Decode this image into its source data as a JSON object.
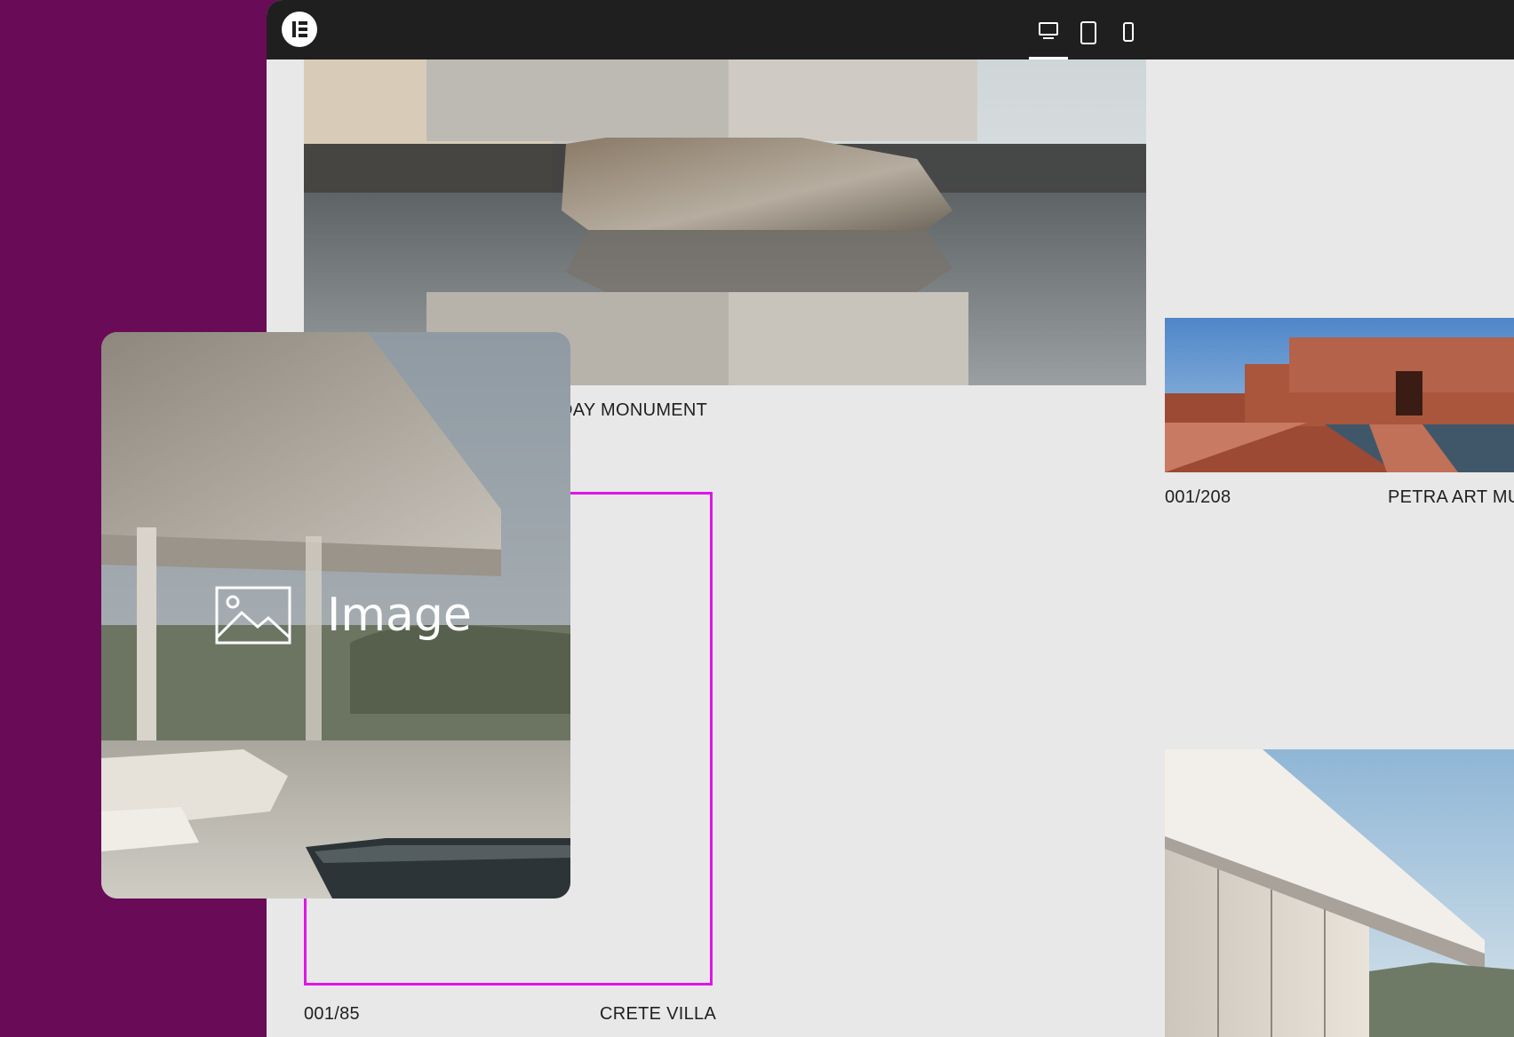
{
  "app": {
    "logo_icon": "elementor-logo-icon",
    "brand_color": "#690b57",
    "accent_color": "#e015e8"
  },
  "device_switcher": {
    "items": [
      {
        "icon": "desktop-icon",
        "active": true
      },
      {
        "icon": "tablet-icon",
        "active": false
      },
      {
        "icon": "mobile-icon",
        "active": false
      }
    ]
  },
  "canvas": {
    "projects": [
      {
        "caption_name": "DAY MONUMENT"
      },
      {
        "caption_number": "001/208",
        "caption_name": "PETRA ART MU"
      },
      {
        "caption_number": "001/85",
        "caption_name": "CRETE VILLA"
      }
    ]
  },
  "drag_widget": {
    "label": "Image",
    "icon": "image-icon"
  }
}
